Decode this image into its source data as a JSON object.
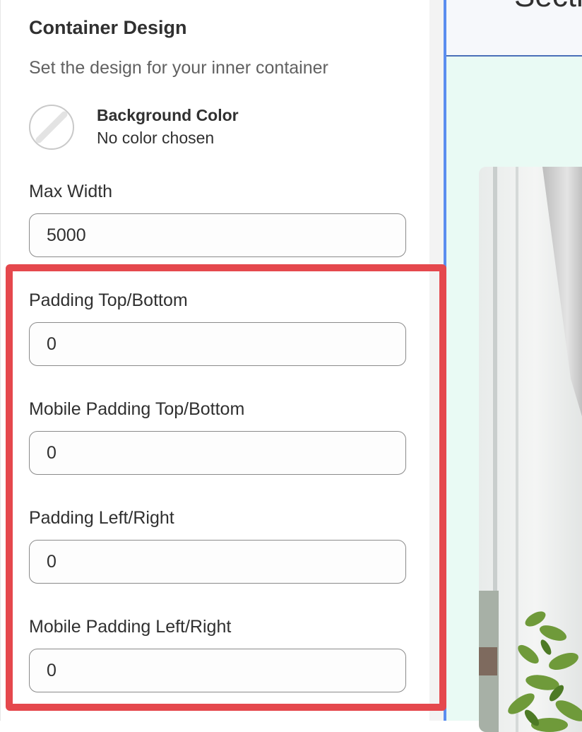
{
  "container": {
    "title": "Container Design",
    "subtitle": "Set the design for your inner container"
  },
  "background_color": {
    "label": "Background Color",
    "value": "No color chosen"
  },
  "fields": {
    "max_width": {
      "label": "Max Width",
      "value": "5000"
    },
    "padding_top_bottom": {
      "label": "Padding Top/Bottom",
      "value": "0"
    },
    "mobile_padding_top_bottom": {
      "label": "Mobile Padding Top/Bottom",
      "value": "0"
    },
    "padding_left_right": {
      "label": "Padding Left/Right",
      "value": "0"
    },
    "mobile_padding_left_right": {
      "label": "Mobile Padding Left/Right",
      "value": "0"
    }
  },
  "preview": {
    "heading": "Secti"
  },
  "colors": {
    "highlight": "#e5484d",
    "preview_background": "#e9faf4",
    "selection_border": "#5b8def"
  }
}
